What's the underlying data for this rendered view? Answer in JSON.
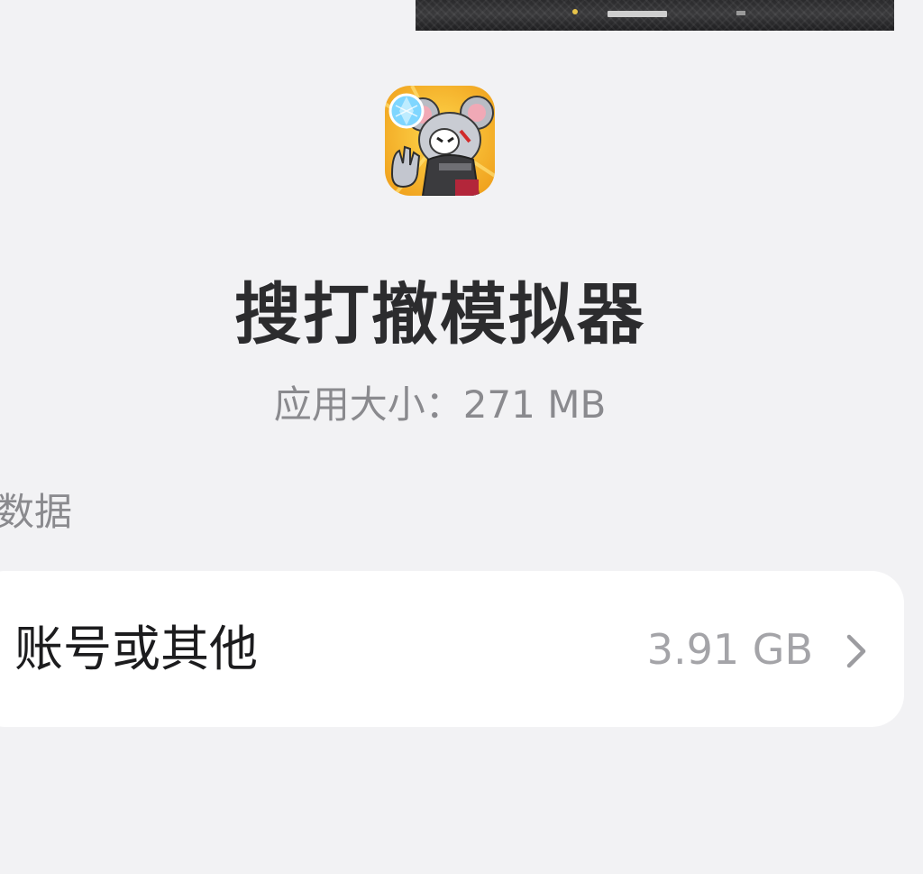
{
  "app": {
    "name": "搜打撤模拟器",
    "size_text": "应用大小：271 MB",
    "icon": "mouse-character-app-icon"
  },
  "section": {
    "title": "数据"
  },
  "data_row": {
    "label": "账号或其他",
    "value": "3.91 GB",
    "icon": "chevron-right-icon"
  },
  "colors": {
    "background": "#f2f2f4",
    "card": "#ffffff",
    "title_text": "#2c2c2e",
    "secondary_text": "#8a8a8e",
    "value_text": "#a4a4a8",
    "icon_bg": "#f4b62a"
  }
}
